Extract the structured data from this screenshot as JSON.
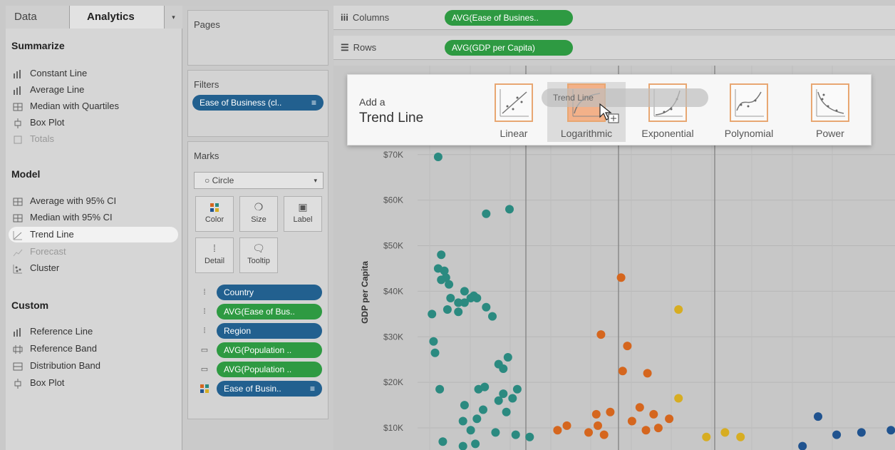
{
  "left_pane": {
    "tabs": {
      "data": "Data",
      "analytics": "Analytics",
      "menu_icon": "dropdown-arrow-icon"
    },
    "summarize": {
      "title": "Summarize",
      "items": [
        {
          "label": "Constant Line",
          "icon": "constant-line-icon",
          "enabled": true
        },
        {
          "label": "Average Line",
          "icon": "average-line-icon",
          "enabled": true
        },
        {
          "label": "Median with Quartiles",
          "icon": "median-quartiles-icon",
          "enabled": true
        },
        {
          "label": "Box Plot",
          "icon": "box-plot-icon",
          "enabled": true
        },
        {
          "label": "Totals",
          "icon": "totals-icon",
          "enabled": false
        }
      ]
    },
    "model": {
      "title": "Model",
      "items": [
        {
          "label": "Average with 95% CI",
          "icon": "average-ci-icon",
          "enabled": true
        },
        {
          "label": "Median with 95% CI",
          "icon": "median-ci-icon",
          "enabled": true
        },
        {
          "label": "Trend Line",
          "icon": "trend-line-icon",
          "enabled": true,
          "highlighted": true
        },
        {
          "label": "Forecast",
          "icon": "forecast-icon",
          "enabled": false
        },
        {
          "label": "Cluster",
          "icon": "cluster-icon",
          "enabled": true
        }
      ]
    },
    "custom": {
      "title": "Custom",
      "items": [
        {
          "label": "Reference Line",
          "icon": "reference-line-icon"
        },
        {
          "label": "Reference Band",
          "icon": "reference-band-icon"
        },
        {
          "label": "Distribution Band",
          "icon": "distribution-band-icon"
        },
        {
          "label": "Box Plot",
          "icon": "box-plot-icon"
        }
      ]
    }
  },
  "cards": {
    "pages": {
      "title": "Pages"
    },
    "filters": {
      "title": "Filters",
      "pill": "Ease of Business (cl.."
    },
    "marks": {
      "title": "Marks",
      "mark_type": "Circle",
      "buttons": [
        {
          "label": "Color",
          "icon": "color-icon"
        },
        {
          "label": "Size",
          "icon": "size-icon"
        },
        {
          "label": "Label",
          "icon": "label-icon"
        },
        {
          "label": "Detail",
          "icon": "detail-icon"
        },
        {
          "label": "Tooltip",
          "icon": "tooltip-icon"
        }
      ],
      "fields": [
        {
          "label": "Country",
          "color": "blue",
          "icon": "detail-icon"
        },
        {
          "label": "AVG(Ease of Bus..",
          "color": "green",
          "icon": "detail-icon"
        },
        {
          "label": "Region",
          "color": "blue",
          "icon": "detail-icon"
        },
        {
          "label": "AVG(Population ..",
          "color": "green",
          "icon": "tooltip-icon"
        },
        {
          "label": "AVG(Population ..",
          "color": "green",
          "icon": "tooltip-icon"
        },
        {
          "label": "Ease of Busin..",
          "color": "blue",
          "icon": "color-icon"
        }
      ]
    }
  },
  "shelves": {
    "columns": {
      "label": "Columns",
      "pill": "AVG(Ease of Busines.."
    },
    "rows": {
      "label": "Rows",
      "pill": "AVG(GDP per Capita)"
    }
  },
  "popup": {
    "add_a": "Add a",
    "title": "Trend Line",
    "drag_label": "Trend Line",
    "options": [
      {
        "label": "Linear",
        "icon": "linear-trend-icon"
      },
      {
        "label": "Logarithmic",
        "icon": "logarithmic-trend-icon",
        "hover": true
      },
      {
        "label": "Exponential",
        "icon": "exponential-trend-icon"
      },
      {
        "label": "Polynomial",
        "icon": "polynomial-trend-icon"
      },
      {
        "label": "Power",
        "icon": "power-trend-icon"
      }
    ]
  },
  "chart_data": {
    "type": "scatter",
    "ylabel": "GDP per Capita",
    "y_ticks": [
      "$10K",
      "$20K",
      "$30K",
      "$40K",
      "$50K",
      "$60K",
      "$70K"
    ],
    "ylim": [
      5000,
      72000
    ],
    "series": [
      {
        "color": "#2b8a80",
        "points": [
          [
            0.05,
            69500
          ],
          [
            0.36,
            57000
          ],
          [
            0.51,
            58000
          ],
          [
            0.07,
            48000
          ],
          [
            0.05,
            45000
          ],
          [
            0.09,
            44500
          ],
          [
            0.1,
            43000
          ],
          [
            0.07,
            42500
          ],
          [
            0.12,
            41500
          ],
          [
            0.22,
            40000
          ],
          [
            0.28,
            39000
          ],
          [
            0.26,
            38500
          ],
          [
            0.3,
            38500
          ],
          [
            0.22,
            37500
          ],
          [
            0.13,
            38500
          ],
          [
            0.18,
            37500
          ],
          [
            0.36,
            36500
          ],
          [
            0.11,
            36000
          ],
          [
            0.18,
            35500
          ],
          [
            0.01,
            35000
          ],
          [
            0.4,
            34500
          ],
          [
            0.02,
            29000
          ],
          [
            0.03,
            26500
          ],
          [
            0.44,
            24000
          ],
          [
            0.5,
            25500
          ],
          [
            0.47,
            23000
          ],
          [
            0.06,
            18500
          ],
          [
            0.31,
            18500
          ],
          [
            0.35,
            19000
          ],
          [
            0.47,
            17500
          ],
          [
            0.56,
            18500
          ],
          [
            0.44,
            16000
          ],
          [
            0.53,
            16500
          ],
          [
            0.22,
            15000
          ],
          [
            0.34,
            14000
          ],
          [
            0.49,
            13500
          ],
          [
            0.3,
            12000
          ],
          [
            0.21,
            11500
          ],
          [
            0.26,
            9500
          ],
          [
            0.42,
            9000
          ],
          [
            0.55,
            8500
          ],
          [
            0.64,
            8000
          ],
          [
            0.08,
            7000
          ],
          [
            0.29,
            6500
          ],
          [
            0.21,
            6000
          ]
        ]
      },
      {
        "color": "#d5661e",
        "points": [
          [
            1.23,
            43000
          ],
          [
            1.1,
            30500
          ],
          [
            1.27,
            28000
          ],
          [
            1.24,
            22500
          ],
          [
            1.4,
            22000
          ],
          [
            1.35,
            14500
          ],
          [
            1.16,
            13500
          ],
          [
            1.07,
            13000
          ],
          [
            1.44,
            13000
          ],
          [
            1.54,
            12000
          ],
          [
            0.88,
            10500
          ],
          [
            1.08,
            10500
          ],
          [
            1.3,
            11500
          ],
          [
            1.47,
            10000
          ],
          [
            1.39,
            9500
          ],
          [
            1.02,
            9000
          ],
          [
            0.82,
            9500
          ],
          [
            1.12,
            8500
          ]
        ]
      },
      {
        "color": "#d7ad22",
        "points": [
          [
            1.6,
            36000
          ],
          [
            1.6,
            16500
          ],
          [
            1.78,
            8000
          ],
          [
            1.9,
            9000
          ],
          [
            2.0,
            8000
          ]
        ]
      },
      {
        "color": "#20538f",
        "points": [
          [
            2.5,
            12500
          ],
          [
            2.62,
            8500
          ],
          [
            2.78,
            9000
          ],
          [
            2.97,
            9500
          ],
          [
            2.4,
            6000
          ]
        ]
      }
    ]
  }
}
